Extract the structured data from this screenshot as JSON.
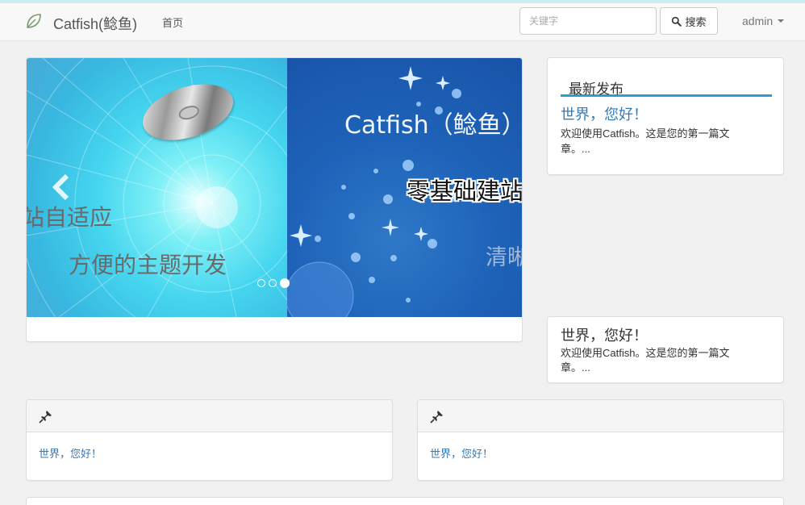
{
  "navbar": {
    "brand": "Catfish(鲶鱼)",
    "home_link": "首页",
    "search_placeholder": "关键字",
    "search_button": "搜索",
    "user": "admin"
  },
  "carousel": {
    "slide_a_line1": "站自适应",
    "slide_a_line2": "方便的主题开发",
    "slide_b_line1": "Catfish（鲶鱼）",
    "slide_b_line2": "零基础建站",
    "slide_b_line3": "清晰",
    "indicator_count": 3,
    "active_indicator": 3
  },
  "latest": {
    "heading": "最新发布",
    "title": "世界，您好！",
    "summary": "欢迎使用Catfish。这是您的第一篇文章。..."
  },
  "post": {
    "title": "世界，您好！",
    "summary": "欢迎使用Catfish。这是您的第一篇文章。..."
  },
  "pinned": [
    {
      "link": "世界，您好！"
    },
    {
      "link": "世界，您好！"
    }
  ],
  "colors": {
    "accent": "#2aa0c9",
    "link": "#337ab7"
  }
}
